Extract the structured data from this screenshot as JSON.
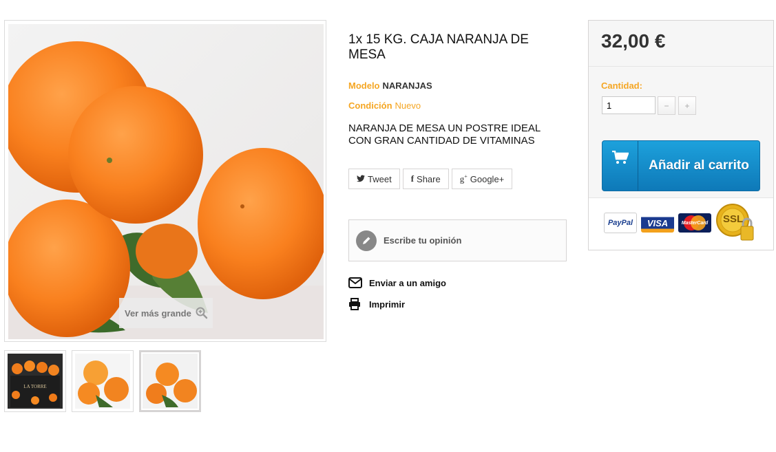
{
  "product": {
    "title": "1x 15 KG. CAJA NARANJA DE MESA",
    "model_label": "Modelo",
    "model_value": "NARANJAS",
    "condition_label": "Condición",
    "condition_value": "Nuevo",
    "description": "NARANJA DE MESA UN POSTRE IDEAL CON GRAN CANTIDAD DE VITAMINAS"
  },
  "gallery": {
    "zoom_label": "Ver más grande",
    "thumb_box_text": "LA TORRE"
  },
  "social": {
    "tweet": "Tweet",
    "share": "Share",
    "google": "Google+"
  },
  "review": {
    "label": "Escribe tu opinión"
  },
  "links": {
    "send_friend": "Enviar a un amigo",
    "print": "Imprimir"
  },
  "buy": {
    "price": "32,00 €",
    "quantity_label": "Cantidad:",
    "quantity_value": "1",
    "add_to_cart": "Añadir al carrito"
  },
  "payments": [
    "PayPal",
    "VISA",
    "MasterCard",
    "SSL"
  ],
  "colors": {
    "accent_orange": "#f5a623",
    "cart_blue": "#1a9ad6",
    "border": "#d6d4d4"
  }
}
